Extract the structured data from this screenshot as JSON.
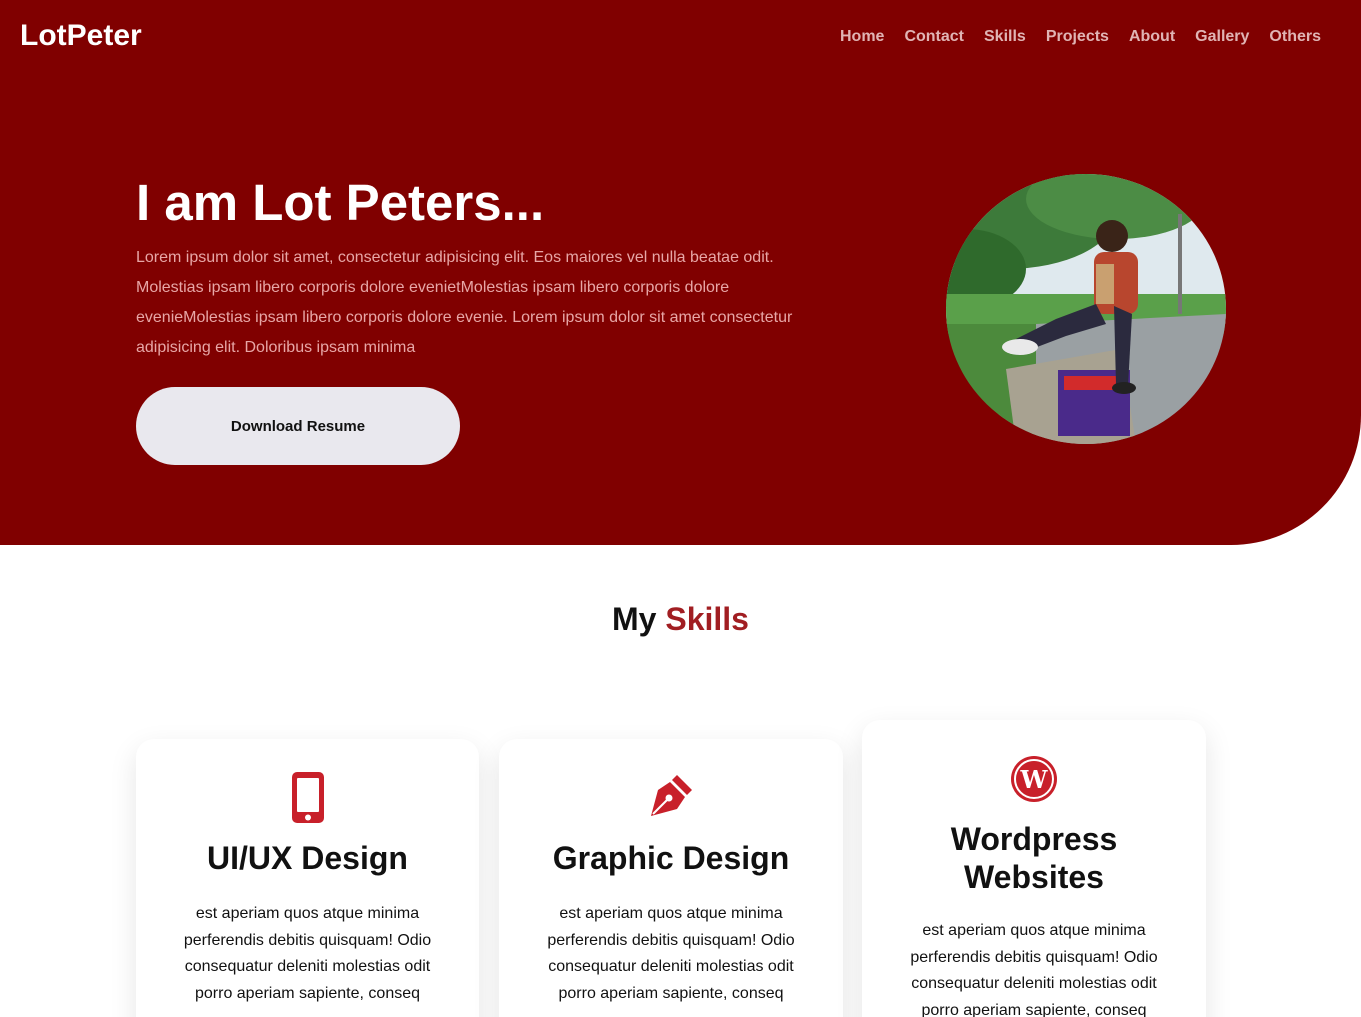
{
  "header": {
    "brand": "LotPeter",
    "nav": [
      "Home",
      "Contact",
      "Skills",
      "Projects",
      "About",
      "Gallery",
      "Others"
    ]
  },
  "hero": {
    "title": "I am Lot Peters...",
    "text": "Lorem ipsum dolor sit amet, consectetur adipisicing elit. Eos maiores vel nulla beatae odit. Molestias ipsam libero corporis dolore evenietMolestias ipsam libero corporis dolore evenieMolestias ipsam libero corporis dolore evenie. Lorem ipsum dolor sit amet consectetur adipisicing elit. Doloribus ipsam minima",
    "button": "Download Resume"
  },
  "skills": {
    "title_prefix": "My",
    "title_accent": "Skills",
    "cards": [
      {
        "icon": "mobile-phone-icon",
        "title": "UI/UX Design",
        "text": "est aperiam quos atque minima perferendis debitis quisquam! Odio consequatur deleniti molestias odit porro aperiam sapiente, conseq"
      },
      {
        "icon": "pen-nib-icon",
        "title": "Graphic Design",
        "text": "est aperiam quos atque minima perferendis debitis quisquam! Odio consequatur deleniti molestias odit porro aperiam sapiente, conseq"
      },
      {
        "icon": "wordpress-icon",
        "title": "Wordpress Websites",
        "text": "est aperiam quos atque minima perferendis debitis quisquam! Odio consequatur deleniti molestias odit porro aperiam sapiente, conseq"
      }
    ]
  },
  "colors": {
    "brand_dark_red": "#800000",
    "accent_red": "#a11e22",
    "button_bg": "#e9e8ee"
  }
}
